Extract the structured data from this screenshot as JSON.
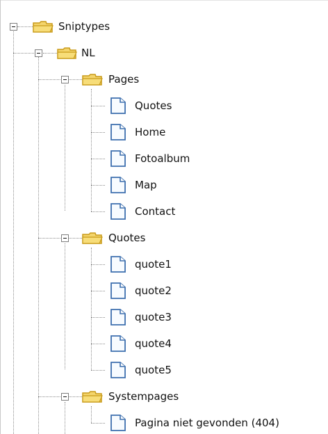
{
  "tree": {
    "root": {
      "label": "Sniptypes",
      "icon": "folder-open-icon",
      "expanded": true,
      "children": {
        "nl": {
          "label": "NL",
          "icon": "folder-open-icon",
          "expanded": true,
          "pages": {
            "label": "Pages",
            "icon": "folder-open-icon",
            "expanded": true,
            "items": [
              "Quotes",
              "Home",
              "Fotoalbum",
              "Map",
              "Contact"
            ]
          },
          "quotes": {
            "label": "Quotes",
            "icon": "folder-open-icon",
            "expanded": true,
            "items": [
              "quote1",
              "quote2",
              "quote3",
              "quote4",
              "quote5"
            ]
          },
          "systempages": {
            "label": "Systempages",
            "icon": "folder-open-icon",
            "expanded": true,
            "items": [
              "Pagina niet gevonden (404)"
            ]
          }
        }
      }
    }
  },
  "colors": {
    "folder_fill": "#f4d56c",
    "folder_outline": "#c89a18",
    "document_outline": "#3d6fae",
    "document_fill": "#f7fbff",
    "connector": "#8c8c8c",
    "toggle_border": "#7c7c7c"
  },
  "icon_names": {
    "folder": "folder-open-icon",
    "document": "document-icon",
    "toggle": "collapse-toggle-icon"
  }
}
